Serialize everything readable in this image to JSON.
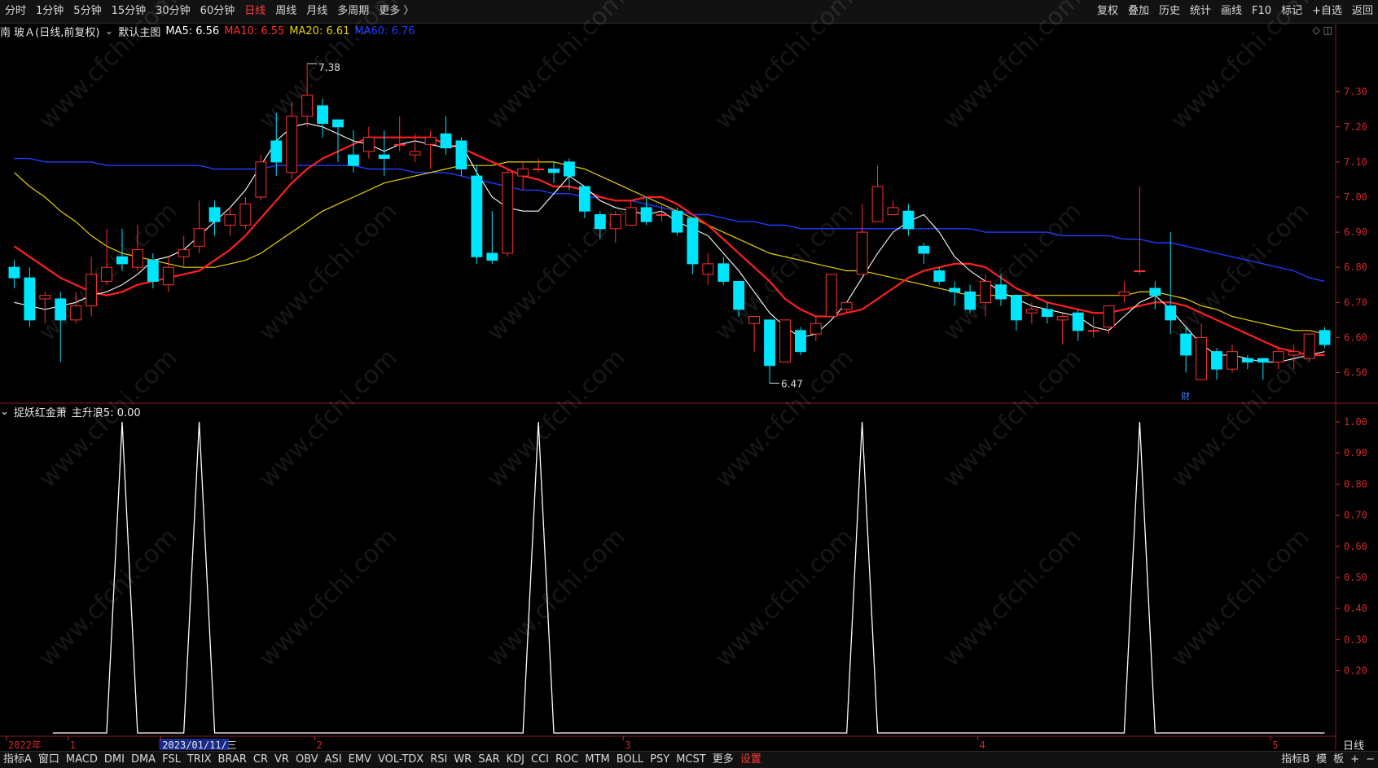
{
  "toolbar": {
    "left_items": [
      "分时",
      "1分钟",
      "5分钟",
      "15分钟",
      "30分钟",
      "60分钟",
      "日线",
      "周线",
      "月线",
      "多周期",
      "更多 〉"
    ],
    "active_item": "日线",
    "right_items": [
      "复权",
      "叠加",
      "历史",
      "统计",
      "画线",
      "F10",
      "标记",
      "+自选",
      "返回"
    ]
  },
  "legend": {
    "stock": "南 玻Ａ(日线,前复权)",
    "template": "默认主图",
    "ma5": "MA5: 6.56",
    "ma10": "MA10: 6.55",
    "ma20": "MA20: 6.61",
    "ma60": "MA60: 6.76"
  },
  "indicator_legend": {
    "name": "捉妖红金萧",
    "value": "主升浪5: 0.00"
  },
  "watermark": "www.cfchi.com",
  "marker": "财",
  "colors": {
    "up": "#ff3030",
    "down": "#00e5ff",
    "ma5": "#ffffff",
    "ma10": "#ff2020",
    "ma20": "#e6d200",
    "ma60": "#1e3cff",
    "axis": "#cc2a2a"
  },
  "chart_data": [
    {
      "type": "candlestick",
      "title": "",
      "y_ticks": [
        "7.30",
        "7.20",
        "7.10",
        "7.00",
        "6.90",
        "6.80",
        "6.70",
        "6.60",
        "6.50"
      ],
      "ylim": [
        6.42,
        7.45
      ],
      "annotations": [
        {
          "label": "7.38",
          "value": 7.38
        },
        {
          "label": "6.47",
          "value": 6.47
        }
      ],
      "candles": [
        [
          6.8,
          6.77,
          6.82,
          6.74
        ],
        [
          6.77,
          6.65,
          6.8,
          6.63
        ],
        [
          6.71,
          6.72,
          6.73,
          6.64
        ],
        [
          6.71,
          6.65,
          6.73,
          6.53
        ],
        [
          6.65,
          6.69,
          6.73,
          6.64
        ],
        [
          6.69,
          6.78,
          6.83,
          6.66
        ],
        [
          6.76,
          6.8,
          6.91,
          6.75
        ],
        [
          6.83,
          6.81,
          6.91,
          6.79
        ],
        [
          6.8,
          6.85,
          6.92,
          6.79
        ],
        [
          6.82,
          6.76,
          6.84,
          6.74
        ],
        [
          6.75,
          6.8,
          6.83,
          6.73
        ],
        [
          6.83,
          6.85,
          6.89,
          6.8
        ],
        [
          6.86,
          6.91,
          6.99,
          6.84
        ],
        [
          6.97,
          6.93,
          6.99,
          6.89
        ],
        [
          6.92,
          6.95,
          6.97,
          6.89
        ],
        [
          6.92,
          6.98,
          7.0,
          6.91
        ],
        [
          7.0,
          7.1,
          7.12,
          6.99
        ],
        [
          7.16,
          7.1,
          7.24,
          7.06
        ],
        [
          7.07,
          7.23,
          7.27,
          7.05
        ],
        [
          7.23,
          7.29,
          7.38,
          7.2
        ],
        [
          7.26,
          7.21,
          7.28,
          7.17
        ],
        [
          7.22,
          7.2,
          7.22,
          7.1
        ],
        [
          7.12,
          7.09,
          7.19,
          7.07
        ],
        [
          7.13,
          7.17,
          7.2,
          7.11
        ],
        [
          7.12,
          7.11,
          7.19,
          7.06
        ],
        [
          7.15,
          7.15,
          7.23,
          7.13
        ],
        [
          7.12,
          7.13,
          7.18,
          7.1
        ],
        [
          7.15,
          7.17,
          7.19,
          7.08
        ],
        [
          7.18,
          7.14,
          7.23,
          7.12
        ],
        [
          7.16,
          7.08,
          7.17,
          7.06
        ],
        [
          7.06,
          6.83,
          7.09,
          6.81
        ],
        [
          6.84,
          6.82,
          6.96,
          6.81
        ],
        [
          6.84,
          7.07,
          7.08,
          6.83
        ],
        [
          7.06,
          7.08,
          7.1,
          7.02
        ],
        [
          7.08,
          7.08,
          7.11,
          7.07
        ],
        [
          7.08,
          7.07,
          7.1,
          7.04
        ],
        [
          7.1,
          7.06,
          7.11,
          7.02
        ],
        [
          7.03,
          6.96,
          7.03,
          6.94
        ],
        [
          6.95,
          6.91,
          6.96,
          6.88
        ],
        [
          6.91,
          6.95,
          6.96,
          6.87
        ],
        [
          6.92,
          6.97,
          6.99,
          6.94
        ],
        [
          6.97,
          6.93,
          7.0,
          6.92
        ],
        [
          6.95,
          6.95,
          6.98,
          6.93
        ],
        [
          6.96,
          6.9,
          6.97,
          6.89
        ],
        [
          6.94,
          6.81,
          6.94,
          6.78
        ],
        [
          6.78,
          6.81,
          6.84,
          6.75
        ],
        [
          6.81,
          6.76,
          6.83,
          6.75
        ],
        [
          6.76,
          6.68,
          6.76,
          6.66
        ],
        [
          6.64,
          6.66,
          6.66,
          6.56
        ],
        [
          6.65,
          6.52,
          6.65,
          6.47
        ],
        [
          6.53,
          6.65,
          6.65,
          6.53
        ],
        [
          6.62,
          6.56,
          6.63,
          6.55
        ],
        [
          6.61,
          6.64,
          6.66,
          6.59
        ],
        [
          6.66,
          6.78,
          6.78,
          6.66
        ],
        [
          6.68,
          6.7,
          6.7,
          6.67
        ],
        [
          6.78,
          6.9,
          6.98,
          6.78
        ],
        [
          6.93,
          7.03,
          7.09,
          6.93
        ],
        [
          6.95,
          6.97,
          6.95,
          6.99
        ],
        [
          6.96,
          6.91,
          6.98,
          6.89
        ],
        [
          6.86,
          6.84,
          6.87,
          6.81
        ],
        [
          6.79,
          6.76,
          6.8,
          6.75
        ],
        [
          6.74,
          6.73,
          6.76,
          6.69
        ],
        [
          6.73,
          6.68,
          6.75,
          6.67
        ],
        [
          6.7,
          6.76,
          6.78,
          6.66
        ],
        [
          6.75,
          6.71,
          6.78,
          6.69
        ],
        [
          6.72,
          6.65,
          6.72,
          6.62
        ],
        [
          6.67,
          6.68,
          6.7,
          6.64
        ],
        [
          6.68,
          6.66,
          6.7,
          6.64
        ],
        [
          6.65,
          6.66,
          6.67,
          6.58
        ],
        [
          6.67,
          6.62,
          6.68,
          6.59
        ],
        [
          6.62,
          6.62,
          6.66,
          6.6
        ],
        [
          6.63,
          6.69,
          6.69,
          6.61
        ],
        [
          6.72,
          6.73,
          6.76,
          6.7
        ],
        [
          6.79,
          6.79,
          7.03,
          6.78
        ],
        [
          6.74,
          6.72,
          6.76,
          6.68
        ],
        [
          6.69,
          6.65,
          6.9,
          6.61
        ],
        [
          6.61,
          6.55,
          6.63,
          6.5
        ],
        [
          6.48,
          6.6,
          6.64,
          6.48
        ],
        [
          6.56,
          6.51,
          6.57,
          6.48
        ],
        [
          6.51,
          6.56,
          6.58,
          6.5
        ],
        [
          6.54,
          6.53,
          6.55,
          6.51
        ],
        [
          6.54,
          6.53,
          6.54,
          6.48
        ],
        [
          6.53,
          6.56,
          6.57,
          6.51
        ],
        [
          6.55,
          6.56,
          6.58,
          6.51
        ],
        [
          6.54,
          6.61,
          6.61,
          6.53
        ],
        [
          6.62,
          6.58,
          6.63,
          6.57
        ]
      ],
      "ma_lines": {
        "MA5": [
          6.7,
          6.69,
          6.68,
          6.69,
          6.7,
          6.72,
          6.73,
          6.75,
          6.78,
          6.82,
          6.83,
          6.85,
          6.89,
          6.93,
          6.97,
          7.02,
          7.09,
          7.16,
          7.2,
          7.21,
          7.2,
          7.18,
          7.16,
          7.15,
          7.13,
          7.15,
          7.16,
          7.15,
          7.14,
          7.15,
          7.07,
          7.0,
          6.97,
          6.96,
          6.96,
          7.01,
          7.06,
          7.03,
          6.99,
          6.97,
          6.96,
          6.95,
          6.96,
          6.93,
          6.91,
          6.89,
          6.84,
          6.79,
          6.73,
          6.67,
          6.63,
          6.6,
          6.61,
          6.65,
          6.7,
          6.77,
          6.84,
          6.9,
          6.93,
          6.95,
          6.9,
          6.83,
          6.79,
          6.76,
          6.73,
          6.71,
          6.69,
          6.68,
          6.67,
          6.66,
          6.63,
          6.62,
          6.66,
          6.7,
          6.72,
          6.68,
          6.63,
          6.58,
          6.55,
          6.55,
          6.54,
          6.53,
          6.53,
          6.54,
          6.55,
          6.56
        ],
        "MA10": [
          6.86,
          6.83,
          6.8,
          6.77,
          6.75,
          6.73,
          6.72,
          6.73,
          6.75,
          6.76,
          6.77,
          6.78,
          6.79,
          6.82,
          6.85,
          6.89,
          6.94,
          6.99,
          7.04,
          7.08,
          7.11,
          7.13,
          7.15,
          7.17,
          7.17,
          7.17,
          7.17,
          7.17,
          7.15,
          7.14,
          7.12,
          7.1,
          7.08,
          7.06,
          7.05,
          7.03,
          7.03,
          7.02,
          7.0,
          6.99,
          6.99,
          7.0,
          7.0,
          6.98,
          6.95,
          6.92,
          6.88,
          6.84,
          6.8,
          6.76,
          6.71,
          6.68,
          6.66,
          6.66,
          6.67,
          6.68,
          6.71,
          6.74,
          6.77,
          6.79,
          6.8,
          6.81,
          6.81,
          6.8,
          6.77,
          6.74,
          6.72,
          6.7,
          6.69,
          6.68,
          6.67,
          6.67,
          6.68,
          6.69,
          6.7,
          6.7,
          6.69,
          6.67,
          6.65,
          6.63,
          6.61,
          6.59,
          6.57,
          6.56,
          6.55,
          6.55
        ],
        "MA20": [
          7.07,
          7.03,
          7.0,
          6.96,
          6.93,
          6.89,
          6.86,
          6.84,
          6.83,
          6.82,
          6.81,
          6.8,
          6.8,
          6.8,
          6.81,
          6.82,
          6.84,
          6.87,
          6.9,
          6.93,
          6.96,
          6.98,
          7.0,
          7.02,
          7.04,
          7.05,
          7.06,
          7.07,
          7.08,
          7.09,
          7.09,
          7.09,
          7.1,
          7.1,
          7.1,
          7.1,
          7.09,
          7.08,
          7.06,
          7.04,
          7.02,
          7.0,
          6.98,
          6.96,
          6.94,
          6.92,
          6.9,
          6.88,
          6.86,
          6.84,
          6.83,
          6.82,
          6.81,
          6.8,
          6.79,
          6.79,
          6.78,
          6.77,
          6.76,
          6.75,
          6.74,
          6.73,
          6.72,
          6.72,
          6.72,
          6.72,
          6.72,
          6.72,
          6.72,
          6.72,
          6.72,
          6.72,
          6.72,
          6.73,
          6.73,
          6.72,
          6.71,
          6.69,
          6.68,
          6.66,
          6.65,
          6.64,
          6.63,
          6.62,
          6.62,
          6.61
        ],
        "MA60": [
          7.11,
          7.11,
          7.1,
          7.1,
          7.1,
          7.1,
          7.09,
          7.09,
          7.09,
          7.09,
          7.09,
          7.09,
          7.09,
          7.08,
          7.08,
          7.08,
          7.08,
          7.09,
          7.09,
          7.09,
          7.09,
          7.09,
          7.09,
          7.08,
          7.08,
          7.08,
          7.07,
          7.07,
          7.07,
          7.06,
          7.05,
          7.04,
          7.03,
          7.02,
          7.02,
          7.01,
          7.01,
          7.0,
          7.0,
          6.99,
          6.99,
          6.98,
          6.97,
          6.96,
          6.95,
          6.95,
          6.94,
          6.93,
          6.93,
          6.92,
          6.92,
          6.91,
          6.91,
          6.91,
          6.91,
          6.91,
          6.91,
          6.91,
          6.91,
          6.91,
          6.91,
          6.91,
          6.91,
          6.9,
          6.9,
          6.9,
          6.9,
          6.9,
          6.89,
          6.89,
          6.89,
          6.89,
          6.88,
          6.88,
          6.87,
          6.87,
          6.86,
          6.85,
          6.84,
          6.83,
          6.82,
          6.81,
          6.8,
          6.79,
          6.77,
          6.76
        ]
      }
    },
    {
      "type": "line",
      "title": "",
      "y_ticks": [
        "1.00",
        "0.90",
        "0.80",
        "0.70",
        "0.60",
        "0.50",
        "0.40",
        "0.30",
        "0.20"
      ],
      "ylim": [
        0,
        1.0
      ],
      "spike_candle_indices": [
        7,
        12,
        34,
        55,
        73
      ],
      "x_ticks": [
        {
          "label": "2022年",
          "idx": 0
        },
        {
          "label": "1",
          "idx": 4
        },
        {
          "label": "2023/01/11/三",
          "idx": 10
        },
        {
          "label": "2",
          "idx": 20
        },
        {
          "label": "3",
          "idx": 40
        },
        {
          "label": "4",
          "idx": 63
        },
        {
          "label": "5",
          "idx": 82
        }
      ]
    }
  ],
  "period_label": "日线",
  "bottombar": {
    "items": [
      "指标A",
      "窗口",
      "MACD",
      "DMI",
      "DMA",
      "FSL",
      "TRIX",
      "BRAR",
      "CR",
      "VR",
      "OBV",
      "ASI",
      "EMV",
      "VOL-TDX",
      "RSI",
      "WR",
      "SAR",
      "KDJ",
      "CCI",
      "ROC",
      "MTM",
      "BOLL",
      "PSY",
      "MCST",
      "更多",
      "设置"
    ],
    "right_items": [
      "指标B",
      "模",
      "板",
      "+",
      "−"
    ]
  }
}
